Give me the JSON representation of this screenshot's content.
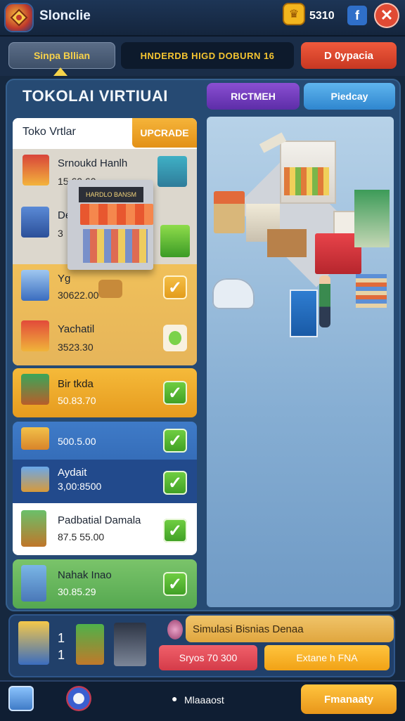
{
  "header": {
    "app_title": "Slonclie",
    "coins": "5310",
    "fb_label": "f",
    "close_label": "✕",
    "coin_icon": "crown-icon"
  },
  "toolbar": {
    "left_button": "Sinpa Bllian",
    "banner": "HNDERDB HIGD DOBURN 16",
    "right_button": "D 0ypacia"
  },
  "main": {
    "title": "TOKOLAI VIRTIUAI",
    "tab_purple": "RICTMEH",
    "tab_blue": "Piedcay",
    "list_header": "Toko Vrtlar",
    "upgrade_label": "UPCRADE",
    "shop_sign": "HARDLO BANSM"
  },
  "items": [
    {
      "name": "Srnoukd Hanlh",
      "price": "15.60.60"
    },
    {
      "name": "Dekt",
      "price": "3"
    },
    {
      "name": "Yg",
      "price": "30622.00"
    },
    {
      "name": "Yachatil",
      "price": "3523.30"
    },
    {
      "name": "Bir tkda",
      "price": "50.83.70"
    },
    {
      "name": "",
      "price": "500.5.00"
    },
    {
      "name": "Aydait",
      "price": "3,00:8500"
    },
    {
      "name": "Padbatial Damala",
      "price": "87.5 55.00"
    },
    {
      "name": "Nahak Inao",
      "price": "30.85.29"
    }
  ],
  "check_mark": "✓",
  "bottom": {
    "count_a": "1",
    "count_b": "1",
    "sim_label": "Simulasi Bisnias Denaa",
    "red_button": "Sryos 70 300",
    "orange_button": "Extane h FNA"
  },
  "footer": {
    "center_label": "Mlaaaost",
    "right_button": "Fmanaaty"
  },
  "colors": {
    "accent_gold": "#f1a216",
    "accent_red": "#d43b49",
    "panel_blue": "#264a73",
    "check_green": "#3e9e24"
  }
}
